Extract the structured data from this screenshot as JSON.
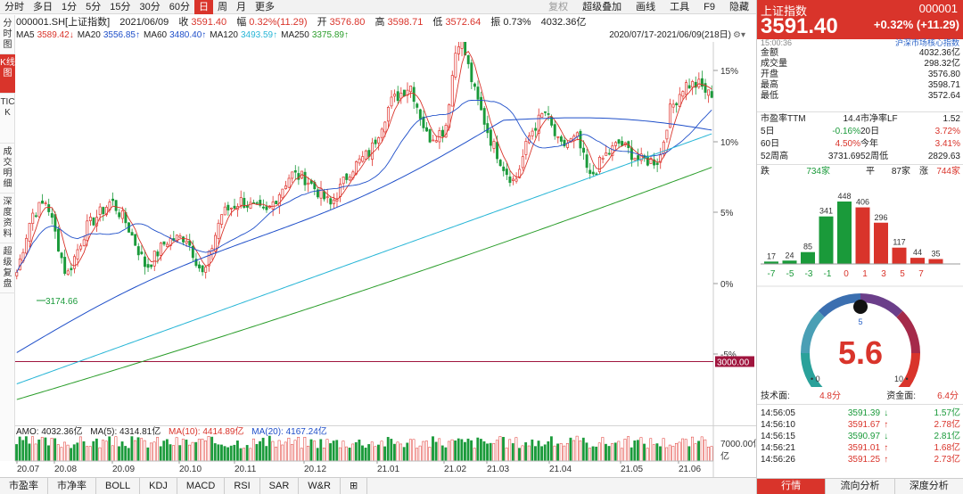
{
  "toolbar": {
    "periods": [
      "分时",
      "多日",
      "1分",
      "5分",
      "15分",
      "30分",
      "60分",
      "日",
      "周",
      "月",
      "更多"
    ],
    "active_period": "日",
    "tools": [
      {
        "label": "复权",
        "dim": true
      },
      {
        "label": "超级叠加",
        "dim": false
      },
      {
        "label": "画线",
        "dim": false
      },
      {
        "label": "工具",
        "dim": false
      },
      {
        "label": "F9",
        "dim": false
      },
      {
        "label": "隐藏",
        "dim": false
      }
    ]
  },
  "info": {
    "code": "000001.SH[上证指数]",
    "date": "2021/06/09",
    "close_label": "收",
    "close": "3591.40",
    "range_label": "幅",
    "range": "0.32%(11.29)",
    "open_label": "开",
    "open": "3576.80",
    "high_label": "高",
    "high": "3598.71",
    "low_label": "低",
    "low": "3572.64",
    "amp_label": "振",
    "amp": "0.73%",
    "amount": "4032.36亿"
  },
  "ma": [
    {
      "label": "MA5",
      "value": "3589.42↓",
      "color": "#d9342b"
    },
    {
      "label": "MA20",
      "value": "3556.85↑",
      "color": "#1f4fc9"
    },
    {
      "label": "MA60",
      "value": "3480.40↑",
      "color": "#1f4fc9"
    },
    {
      "label": "MA120",
      "value": "3493.59↑",
      "color": "#26b5d6"
    },
    {
      "label": "MA250",
      "value": "3375.89↑",
      "color": "#2a9d2a"
    }
  ],
  "range_text": "2020/07/17-2021/06/09(218日)",
  "vtabs": [
    {
      "label": "分时图",
      "active": false
    },
    {
      "label": "K线图",
      "active": true
    },
    {
      "label": "TICK",
      "active": false
    },
    {
      "label": "成交明细",
      "active": false
    },
    {
      "label": "深度资料",
      "active": false
    },
    {
      "label": "超级复盘",
      "active": false
    }
  ],
  "chart": {
    "pct_ticks": [
      "15%",
      "10%",
      "5%",
      "0%",
      "-5%"
    ],
    "peak_label": "3731.69",
    "low_label": "3174.66",
    "line_label": "3000.00",
    "x_ticks": [
      "20.07",
      "20.08",
      "20.09",
      "20.10",
      "20.11",
      "20.12",
      "21.01",
      "21.02",
      "21.03",
      "21.04",
      "21.05",
      "21.06"
    ]
  },
  "chart_data": {
    "type": "candlestick",
    "series": [
      {
        "name": "上证指数",
        "x_start": "2020/07/17",
        "x_end": "2021/06/09",
        "bars": 218
      },
      {
        "name": "MA5"
      },
      {
        "name": "MA20"
      },
      {
        "name": "MA60"
      },
      {
        "name": "MA120"
      },
      {
        "name": "MA250"
      }
    ],
    "annotations": [
      {
        "label": "3731.69",
        "type": "high"
      },
      {
        "label": "3174.66",
        "type": "low"
      },
      {
        "label": "3000.00",
        "type": "horizontal-line"
      }
    ]
  },
  "amo": {
    "amo": "AMO: 4032.36亿",
    "ma5": "MA(5): 4314.81亿",
    "ma10": "MA(10): 4414.89亿",
    "ma20": "MA(20): 4167.24亿",
    "scale": "7000.00亿",
    "unit": "亿"
  },
  "bottom_tabs": [
    "市盈率",
    "市净率",
    "BOLL",
    "KDJ",
    "MACD",
    "RSI",
    "SAR",
    "W&R",
    "⊞"
  ],
  "right": {
    "name": "上证指数",
    "code": "000001",
    "price": "3591.40",
    "change": "+0.32%  (+11.29)",
    "time": "15:00:36",
    "link": "沪深市场核心指数",
    "rows": [
      {
        "k": "金额",
        "v": "4032.36亿",
        "c": ""
      },
      {
        "k": "成交量",
        "v": "298.32亿",
        "c": ""
      },
      {
        "k": "开盘",
        "v": "3576.80",
        "c": "red"
      },
      {
        "k": "最高",
        "v": "3598.71",
        "c": "red"
      },
      {
        "k": "最低",
        "v": "3572.64",
        "c": "red"
      }
    ],
    "grid": [
      [
        {
          "k": "市盈率TTM",
          "v": "14.4"
        },
        {
          "k": "市净率LF",
          "v": "1.52"
        }
      ],
      [
        {
          "k": "5日",
          "v": "-0.16%",
          "c": "green"
        },
        {
          "k": "20日",
          "v": "3.72%",
          "c": "red"
        }
      ],
      [
        {
          "k": "60日",
          "v": "4.50%",
          "c": "red"
        },
        {
          "k": "今年",
          "v": "3.41%",
          "c": "red"
        }
      ],
      [
        {
          "k": "52周高",
          "v": "3731.69"
        },
        {
          "k": "52周低",
          "v": "2829.63"
        }
      ]
    ],
    "breadth": {
      "down_label": "跌",
      "down": "734家",
      "flat_label": "平",
      "flat": "87家",
      "up_label": "涨",
      "up": "744家"
    },
    "hist": {
      "values": [
        17,
        24,
        85,
        341,
        448,
        406,
        296,
        117,
        44,
        35
      ],
      "labels": [
        "17",
        "24",
        "85",
        "341",
        "448",
        "406",
        "296",
        "117",
        "44",
        "35"
      ],
      "axis": [
        "-7",
        "-5",
        "-3",
        "-1",
        "0",
        "1",
        "3",
        "5",
        "7"
      ]
    },
    "gauge": {
      "value": "5.6",
      "top": "5",
      "left": "0",
      "right": "10"
    },
    "scores": {
      "tech_label": "技术面:",
      "tech": "4.8分",
      "fund_label": "资金面:",
      "fund": "6.4分"
    },
    "ticks": [
      {
        "t": "14:56:05",
        "p": "3591.39",
        "d": "↓",
        "c": "green",
        "a": "1.57亿"
      },
      {
        "t": "14:56:10",
        "p": "3591.67",
        "d": "↑",
        "c": "red",
        "a": "2.78亿"
      },
      {
        "t": "14:56:15",
        "p": "3590.97",
        "d": "↓",
        "c": "green",
        "a": "2.81亿"
      },
      {
        "t": "14:56:21",
        "p": "3591.01",
        "d": "↑",
        "c": "red",
        "a": "1.68亿"
      },
      {
        "t": "14:56:26",
        "p": "3591.25",
        "d": "↑",
        "c": "red",
        "a": "2.73亿"
      }
    ],
    "tabs": [
      {
        "label": "行情",
        "active": true
      },
      {
        "label": "流向分析",
        "active": false
      },
      {
        "label": "深度分析",
        "active": false
      }
    ]
  }
}
